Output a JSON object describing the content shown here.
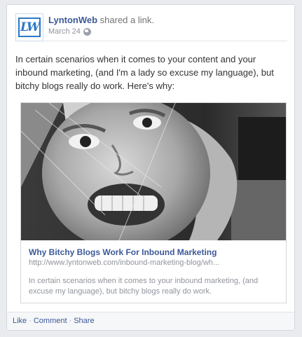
{
  "post": {
    "author": "LyntonWeb",
    "action": " shared a link.",
    "date": "March 24",
    "logo_text": "LW",
    "message": "In certain scenarios when it comes to your content and your inbound marketing, (and I'm a lady so excuse my language), but bitchy blogs really do work. Here's why:"
  },
  "attachment": {
    "title": "Why Bitchy Blogs Work For Inbound Marketing",
    "url": "http://www.lyntonweb.com/inbound-marketing-blog/wh...",
    "description": "In certain scenarios when it comes to your inbound marketing, (and excuse my language), but bitchy blogs really do work."
  },
  "actions": {
    "like": "Like",
    "comment": "Comment",
    "share": "Share",
    "separator": "·"
  },
  "icons": {
    "privacy": "globe-icon"
  },
  "colors": {
    "link_blue": "#3b5998",
    "meta_gray": "#90949c",
    "logo_blue": "#2c79c7"
  }
}
